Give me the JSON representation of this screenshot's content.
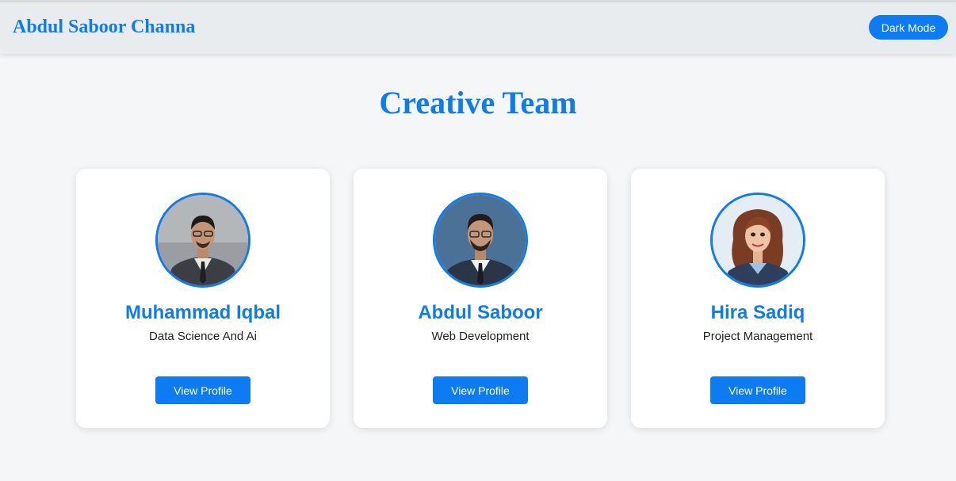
{
  "header": {
    "brand": "Abdul Saboor Channa",
    "mode_toggle_label": "Dark Mode"
  },
  "main": {
    "title": "Creative Team",
    "members": [
      {
        "name": "Muhammad Iqbal",
        "role": "Data Science And Ai",
        "button_label": "View Profile",
        "avatar": "man-suit-photo"
      },
      {
        "name": "Abdul Saboor",
        "role": "Web Development",
        "button_label": "View Profile",
        "avatar": "man-suit-photo"
      },
      {
        "name": "Hira Sadiq",
        "role": "Project Management",
        "button_label": "View Profile",
        "avatar": "woman-cartoon-illustration"
      }
    ]
  },
  "colors": {
    "accent": "#0d7bf2",
    "header_bg": "#e9ecef",
    "page_bg": "#f5f6f8",
    "card_bg": "#ffffff"
  }
}
